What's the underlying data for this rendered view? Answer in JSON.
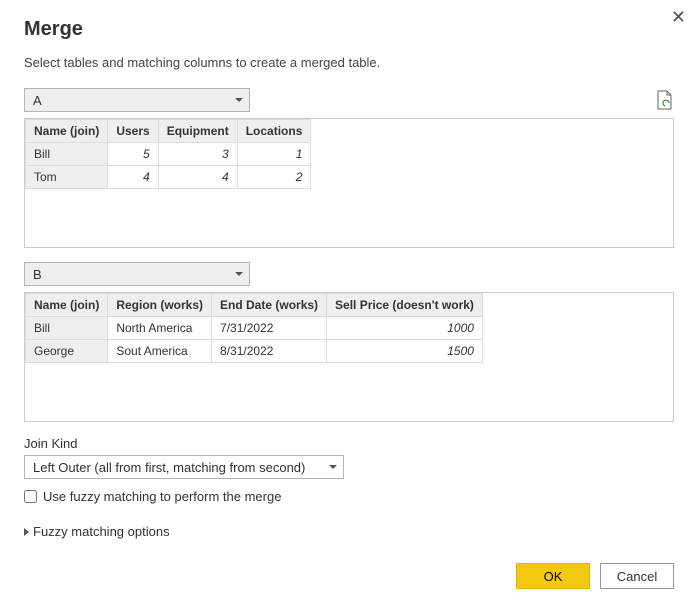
{
  "dialog": {
    "title": "Merge",
    "subtitle": "Select tables and matching columns to create a merged table."
  },
  "tableA": {
    "selected": "A",
    "columns": [
      "Name (join)",
      "Users",
      "Equipment",
      "Locations"
    ],
    "rows": [
      {
        "name": "Bill",
        "users": "5",
        "equipment": "3",
        "locations": "1"
      },
      {
        "name": "Tom",
        "users": "4",
        "equipment": "4",
        "locations": "2"
      }
    ]
  },
  "tableB": {
    "selected": "B",
    "columns": [
      "Name (join)",
      "Region (works)",
      "End Date (works)",
      "Sell Price (doesn't work)"
    ],
    "rows": [
      {
        "name": "Bill",
        "region": "North America",
        "end": "7/31/2022",
        "price": "1000"
      },
      {
        "name": "George",
        "region": "Sout America",
        "end": "8/31/2022",
        "price": "1500"
      }
    ]
  },
  "joinKind": {
    "label": "Join Kind",
    "selected": "Left Outer (all from first, matching from second)"
  },
  "fuzzy": {
    "checkbox_label": "Use fuzzy matching to perform the merge",
    "expander_label": "Fuzzy matching options"
  },
  "buttons": {
    "ok": "OK",
    "cancel": "Cancel"
  }
}
